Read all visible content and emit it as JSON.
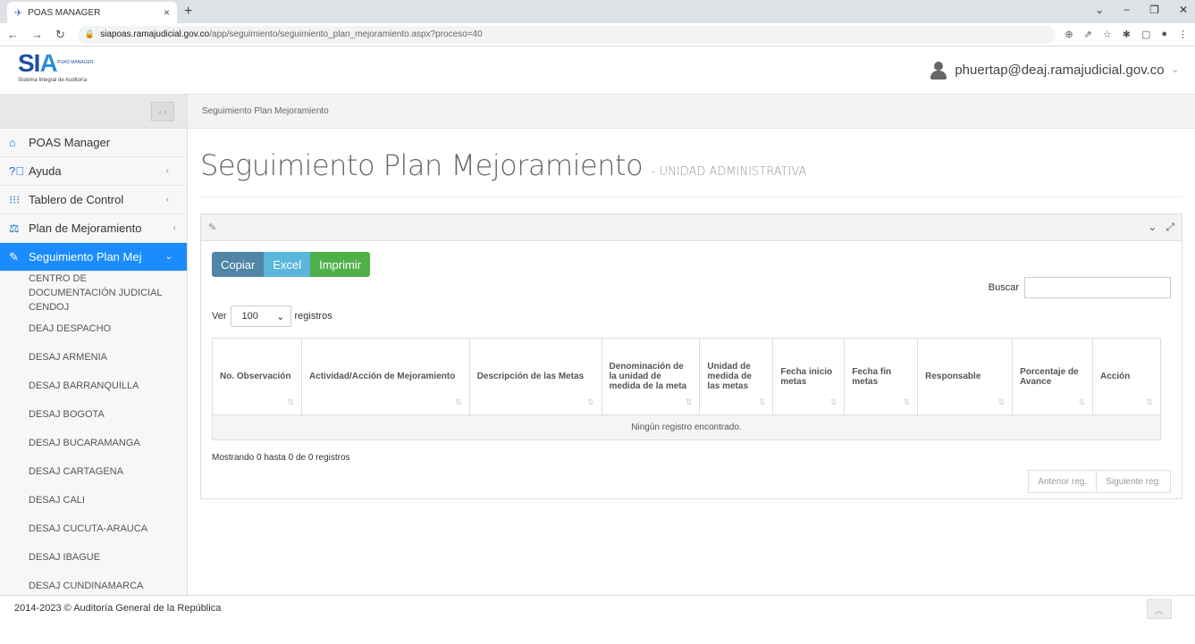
{
  "browser": {
    "tab_title": "POAS MANAGER",
    "url_host": "siapoas.ramajudicial.gov.co",
    "url_path": "/app/seguimiento/seguimiento_plan_mejoramiento.aspx?proceso=40"
  },
  "header": {
    "logo_text_a": "SI",
    "logo_text_b": "A",
    "logo_tag": "POAS MANAGER",
    "logo_sub": "Sistema Integral de Auditoría",
    "user_email": "phuertap@deaj.ramajudicial.gov.co"
  },
  "sidebar": {
    "items": [
      {
        "label": "POAS Manager",
        "icon": "home-icon"
      },
      {
        "label": "Ayuda",
        "icon": "help-icon"
      },
      {
        "label": "Tablero de Control",
        "icon": "grid-icon"
      },
      {
        "label": "Plan de Mejoramiento",
        "icon": "scale-icon"
      },
      {
        "label": "Seguimiento Plan Mej",
        "icon": "pencil-icon"
      }
    ],
    "sub_items": [
      "CENTRO DE DOCUMENTACIÓN JUDICIAL CENDOJ",
      "DEAJ DESPACHO",
      "DESAJ ARMENIA",
      "DESAJ BARRANQUILLA",
      "DESAJ BOGOTA",
      "DESAJ BUCARAMANGA",
      "DESAJ CARTAGENA",
      "DESAJ CALI",
      "DESAJ CUCUTA-ARAUCA",
      "DESAJ IBAGUE",
      "DESAJ CUNDINAMARCA"
    ]
  },
  "breadcrumb": "Seguimiento Plan Mejoramiento",
  "page": {
    "title": "Seguimiento Plan Mejoramiento",
    "subtitle": "- UNIDAD ADMINISTRATIVA"
  },
  "toolbar": {
    "copy": "Copiar",
    "excel": "Excel",
    "print": "Imprimir",
    "search_label": "Buscar",
    "length_prefix": "Ver",
    "length_value": "100",
    "length_suffix": "registros"
  },
  "table": {
    "headers": [
      "No. Observación",
      "Actividad/Acción de Mejoramiento",
      "Descripción de las Metas",
      "Denominación de la unidad de medida de la meta",
      "Unidad de medida de las metas",
      "Fecha inicio metas",
      "Fecha fin metas",
      "Responsable",
      "Porcentaje de Avance",
      "Acción"
    ],
    "empty_message": "Ningún registro encontrado."
  },
  "info": "Mostrando 0 hasta 0 de 0 registros",
  "pager": {
    "prev": "Anterior reg.",
    "next": "Siguiente reg."
  },
  "footer": "2014-2023 © Auditoría General de la República"
}
